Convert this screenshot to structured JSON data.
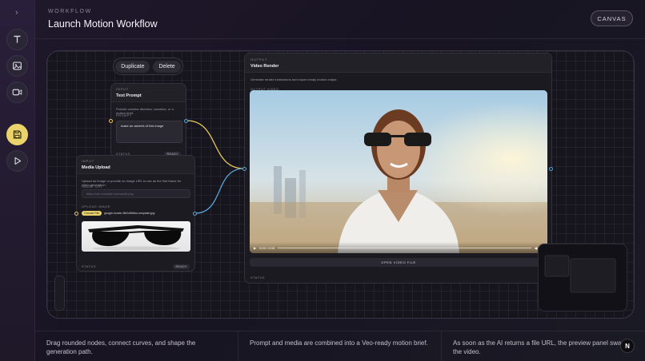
{
  "header": {
    "eyebrow": "WORKFLOW",
    "title": "Launch Motion Workflow",
    "canvas_button": "CANVAS"
  },
  "sidebar": {
    "items": [
      {
        "icon": "text-icon",
        "active": false
      },
      {
        "icon": "image-icon",
        "active": false
      },
      {
        "icon": "video-icon",
        "active": false
      },
      {
        "icon": "save-icon",
        "active": true
      },
      {
        "icon": "play-icon",
        "active": false
      }
    ]
  },
  "toolbar": {
    "duplicate_label": "Duplicate",
    "delete_label": "Delete"
  },
  "text_prompt_node": {
    "kicker": "INPUT",
    "title": "Text Prompt",
    "description": "Provide creative direction, narrative, or a motion brief.",
    "field_label": "PROMPT",
    "prompt_value": "make an adverts of this image",
    "status_label": "STATUS",
    "status_value": "READY"
  },
  "media_upload_node": {
    "kicker": "INPUT",
    "title": "Media Upload",
    "description": "Upload an image or provide an image URL to use as the first frame for video generation.",
    "url_label": "IMAGE URL",
    "url_placeholder": "https://cdn.example.com/asset.png",
    "upload_label": "UPLOAD IMAGE",
    "choose_file": "Choose File",
    "file_name": "google-lovate-4fb2u5b8no-unsplash.jpg",
    "status_label": "STATUS",
    "status_value": "READY"
  },
  "output_node": {
    "kicker": "OUTPUT",
    "title": "Video Render",
    "description": "Generate render instructions and export-ready motion output.",
    "video_label": "OUTPUT VIDEO",
    "time": "0:00 / 0:08",
    "open_button": "OPEN VIDEO FILE",
    "status_label": "STATUS"
  },
  "footer": {
    "items": [
      "Drag rounded nodes, connect curves, and shape the generation path.",
      "Prompt and media are combined into a Veo-ready motion brief.",
      "As soon as the AI returns a file URL, the preview panel swaps the video."
    ],
    "badge": "N"
  },
  "colors": {
    "accent": "#e9d36a",
    "wire_yellow": "#e9c85e",
    "wire_blue": "#5aa6d6"
  }
}
